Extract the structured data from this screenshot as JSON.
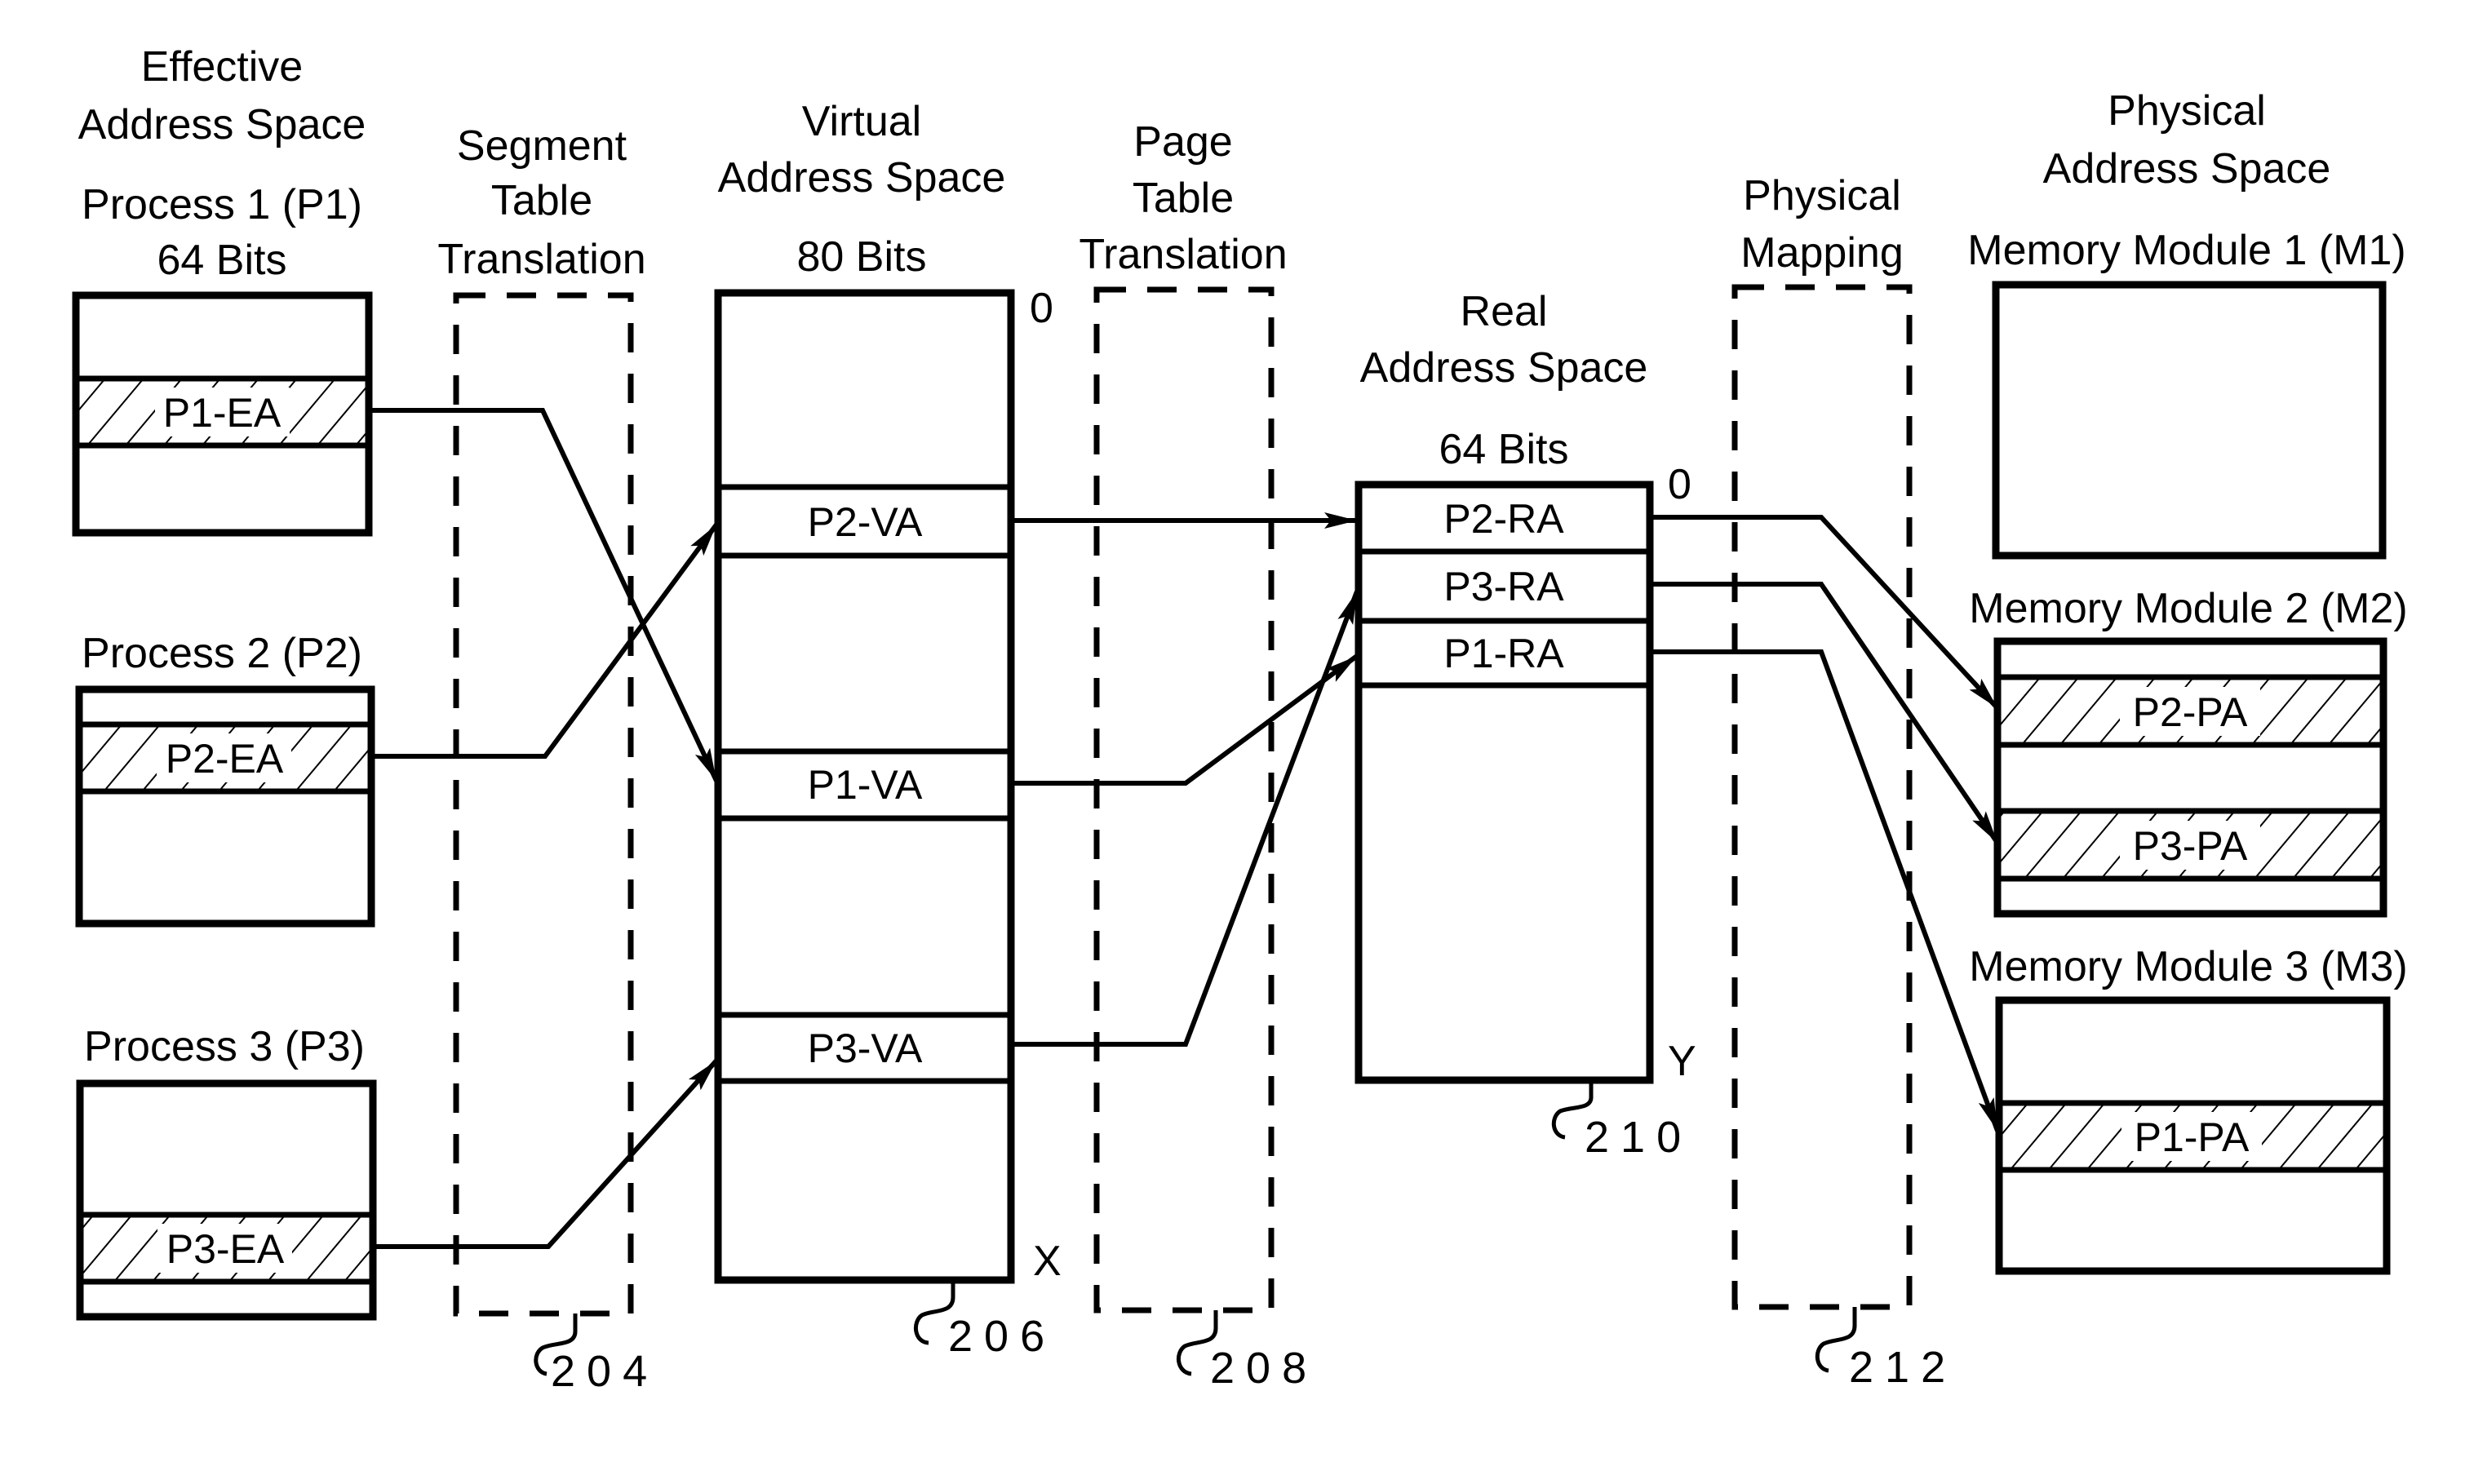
{
  "figure": {
    "columns": {
      "effective": {
        "title_line1": "Effective",
        "title_line2": "Address Space",
        "processes": [
          {
            "name": "Process 1 (P1)",
            "bits": "64 Bits",
            "segment": "P1-EA"
          },
          {
            "name": "Process 2 (P2)",
            "segment": "P2-EA"
          },
          {
            "name": "Process 3 (P3)",
            "segment": "P3-EA"
          }
        ]
      },
      "segment_table": {
        "line1": "Segment",
        "line2": "Table",
        "line3": "Translation",
        "ref": "204"
      },
      "virtual": {
        "title_line1": "Virtual",
        "title_line2": "Address Space",
        "bits": "80 Bits",
        "start_mark": "0",
        "end_mark": "X",
        "segments": [
          "P2-VA",
          "P1-VA",
          "P3-VA"
        ],
        "ref": "206"
      },
      "page_table": {
        "line1": "Page",
        "line2": "Table",
        "line3": "Translation",
        "ref": "208"
      },
      "real": {
        "title_line1": "Real",
        "title_line2": "Address Space",
        "bits": "64 Bits",
        "start_mark": "0",
        "end_mark": "Y",
        "segments": [
          "P2-RA",
          "P3-RA",
          "P1-RA"
        ],
        "ref": "210"
      },
      "physical_mapping": {
        "line1": "Physical",
        "line2": "Mapping",
        "ref": "212"
      },
      "physical": {
        "title_line1": "Physical",
        "title_line2": "Address Space",
        "modules": [
          {
            "name": "Memory Module 1 (M1)",
            "segments": []
          },
          {
            "name": "Memory Module 2 (M2)",
            "segments": [
              "P2-PA",
              "P3-PA"
            ]
          },
          {
            "name": "Memory Module 3 (M3)",
            "segments": [
              "P1-PA"
            ]
          }
        ]
      }
    },
    "mappings": [
      {
        "from": "P1-EA",
        "to": "P1-VA"
      },
      {
        "from": "P2-EA",
        "to": "P2-VA"
      },
      {
        "from": "P3-EA",
        "to": "P3-VA"
      },
      {
        "from": "P2-VA",
        "to": "P2-RA"
      },
      {
        "from": "P1-VA",
        "to": "P1-RA"
      },
      {
        "from": "P3-VA",
        "to": "P3-RA"
      },
      {
        "from": "P2-RA",
        "to": "P2-PA"
      },
      {
        "from": "P3-RA",
        "to": "P3-PA"
      },
      {
        "from": "P1-RA",
        "to": "P1-PA"
      }
    ]
  }
}
